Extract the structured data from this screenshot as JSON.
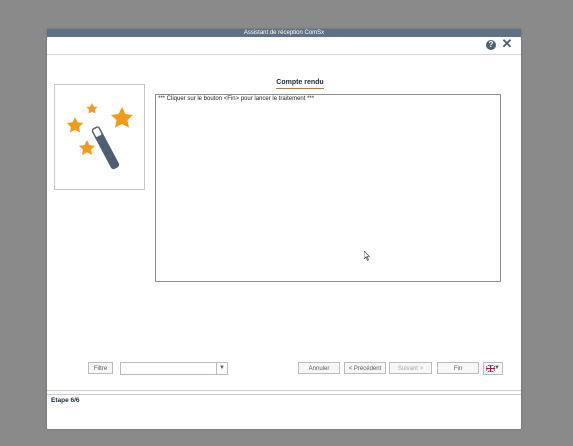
{
  "window": {
    "title": "Assistant de réception ComSx"
  },
  "header": {
    "help_icon": "help-icon",
    "close_icon": "close-icon"
  },
  "wizard": {
    "image_icon": "magic-wand-stars-icon",
    "colors": {
      "star": "#f29a1a",
      "wand": "#4f5f73"
    }
  },
  "section": {
    "title": "Compte rendu"
  },
  "log": {
    "lines": [
      "*** Cliquer sur le bouton <Fin> pour lancer le traitement ***"
    ]
  },
  "footer": {
    "filter_label": "Filtre",
    "filter_value": "",
    "buttons": {
      "cancel": "Annuler",
      "previous": "< Précédent",
      "next": "Suivant >",
      "finish": "Fin"
    },
    "step_label": "Etape 6/6"
  }
}
